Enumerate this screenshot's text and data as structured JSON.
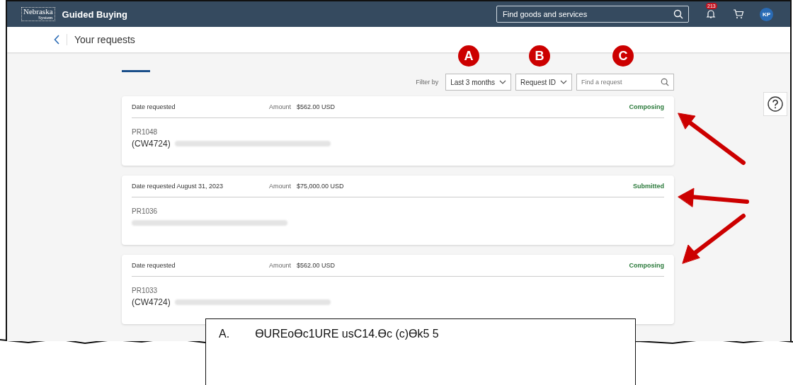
{
  "header": {
    "logo": "Nebraska",
    "logo_sub": "System",
    "title": "Guided Buying",
    "search": {
      "placeholder": "Find goods and services"
    },
    "notifications": "213",
    "avatar": "KP"
  },
  "subheader": {
    "title": "Your requests"
  },
  "markers": [
    {
      "label": "A"
    },
    {
      "label": "B"
    },
    {
      "label": "C"
    }
  ],
  "filter": {
    "label": "Filter by",
    "period": "Last 3 months",
    "sort": "Request ID",
    "search": {
      "placeholder": "Find a request"
    }
  },
  "requests": [
    {
      "date_label": "Date requested",
      "amount_label": "Amount",
      "amount": "$562.00 USD",
      "status": "Composing",
      "id": "PR1048",
      "prefix": "(CW4724)"
    },
    {
      "date_label": "Date requested",
      "date": "August 31, 2023",
      "amount_label": "Amount",
      "amount": "$75,000.00 USD",
      "status": "Submitted",
      "id": "PR1036"
    },
    {
      "date_label": "Date requested",
      "amount_label": "Amount",
      "amount": "$562.00 USD",
      "status": "Composing",
      "id": "PR1033",
      "prefix": "(CW4724)"
    }
  ],
  "caption": {
    "marker": "A.",
    "text": "ƟUREoƟc1URE usC14.Ɵc (c)Ɵk5 5"
  }
}
